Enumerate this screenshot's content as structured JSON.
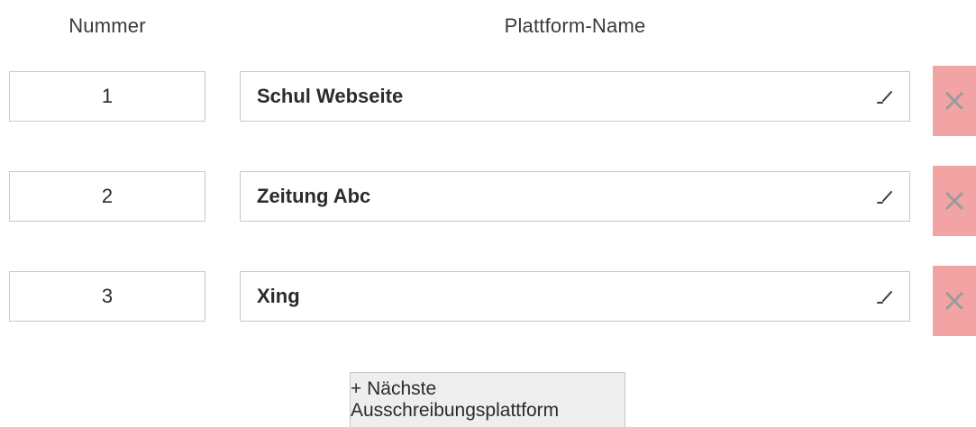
{
  "headers": {
    "number": "Nummer",
    "platform_name": "Plattform-Name"
  },
  "rows": [
    {
      "number": "1",
      "name": "Schul Webseite"
    },
    {
      "number": "2",
      "name": "Zeitung Abc"
    },
    {
      "number": "3",
      "name": "Xing"
    }
  ],
  "icons": {
    "edit": "pencil-icon",
    "delete": "close-icon"
  },
  "colors": {
    "delete_background": "#f2a3a3",
    "delete_icon": "#9a9a9a",
    "add_button_background": "#eeeeee"
  },
  "add_button_label": "+ Nächste Ausschreibungsplattform"
}
